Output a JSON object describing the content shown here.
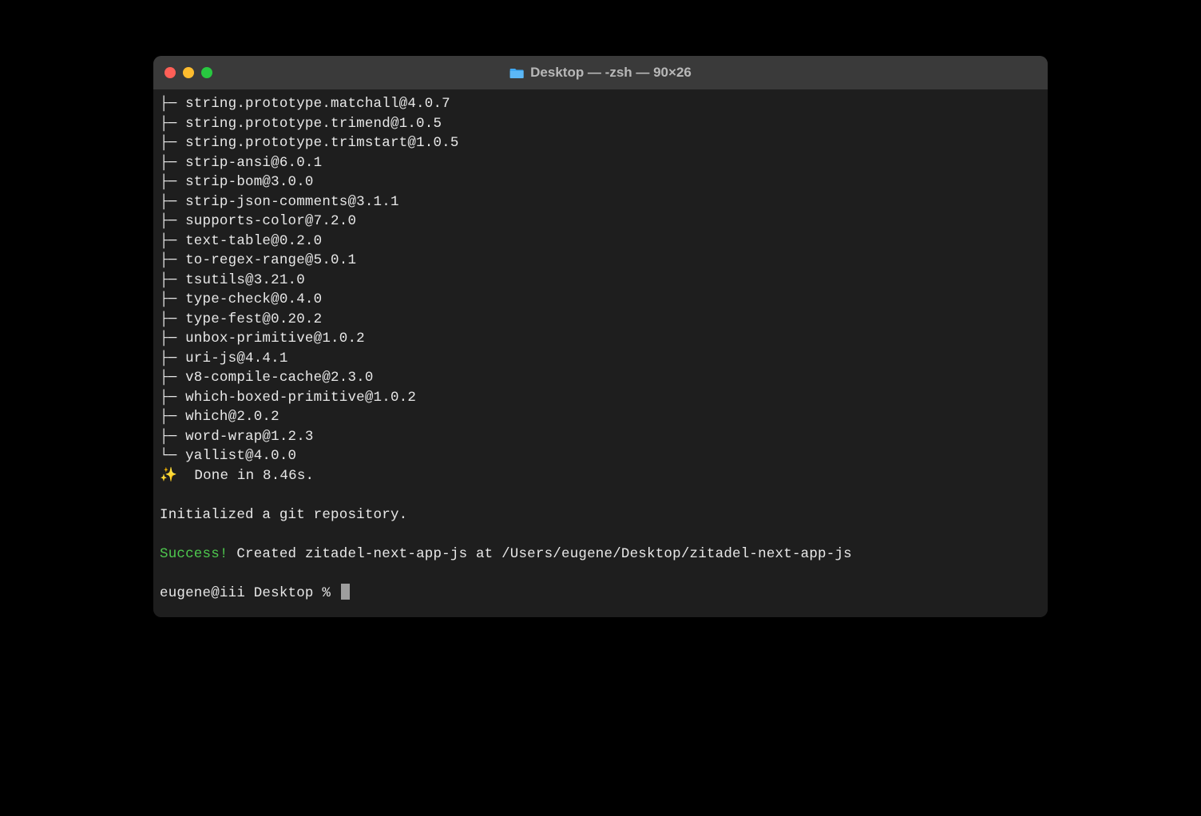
{
  "window": {
    "title": "Desktop — -zsh — 90×26"
  },
  "packages": [
    "string.prototype.matchall@4.0.7",
    "string.prototype.trimend@1.0.5",
    "string.prototype.trimstart@1.0.5",
    "strip-ansi@6.0.1",
    "strip-bom@3.0.0",
    "strip-json-comments@3.1.1",
    "supports-color@7.2.0",
    "text-table@0.2.0",
    "to-regex-range@5.0.1",
    "tsutils@3.21.0",
    "type-check@0.4.0",
    "type-fest@0.20.2",
    "unbox-primitive@1.0.2",
    "uri-js@4.4.1",
    "v8-compile-cache@2.3.0",
    "which-boxed-primitive@1.0.2",
    "which@2.0.2",
    "word-wrap@1.2.3",
    "yallist@4.0.0"
  ],
  "tree": {
    "mid": "├─ ",
    "last": "└─ "
  },
  "done": {
    "sparkle": "✨",
    "text": "  Done in 8.46s."
  },
  "git_line": "Initialized a git repository.",
  "success": {
    "label": "Success!",
    "message": " Created zitadel-next-app-js at /Users/eugene/Desktop/zitadel-next-app-js"
  },
  "prompt": "eugene@iii Desktop % "
}
